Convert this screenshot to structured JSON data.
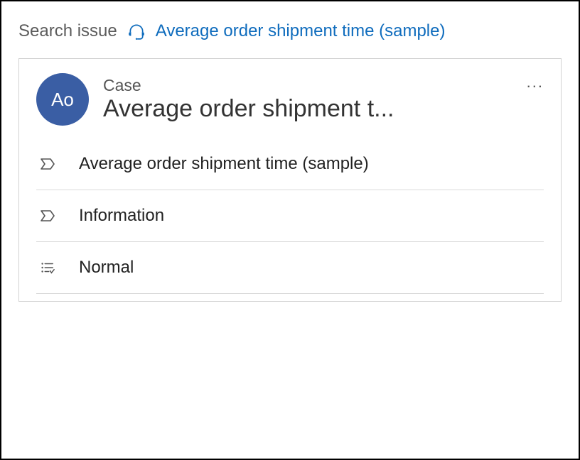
{
  "breadcrumb": {
    "inactive": "Search issue",
    "active": "Average order shipment time (sample)"
  },
  "card": {
    "avatar_initials": "Ao",
    "subtitle": "Case",
    "title": "Average order shipment t...",
    "rows": [
      {
        "icon": "chevron",
        "label": "Average order shipment time (sample)"
      },
      {
        "icon": "chevron",
        "label": "Information"
      },
      {
        "icon": "filter",
        "label": "Normal"
      }
    ]
  }
}
